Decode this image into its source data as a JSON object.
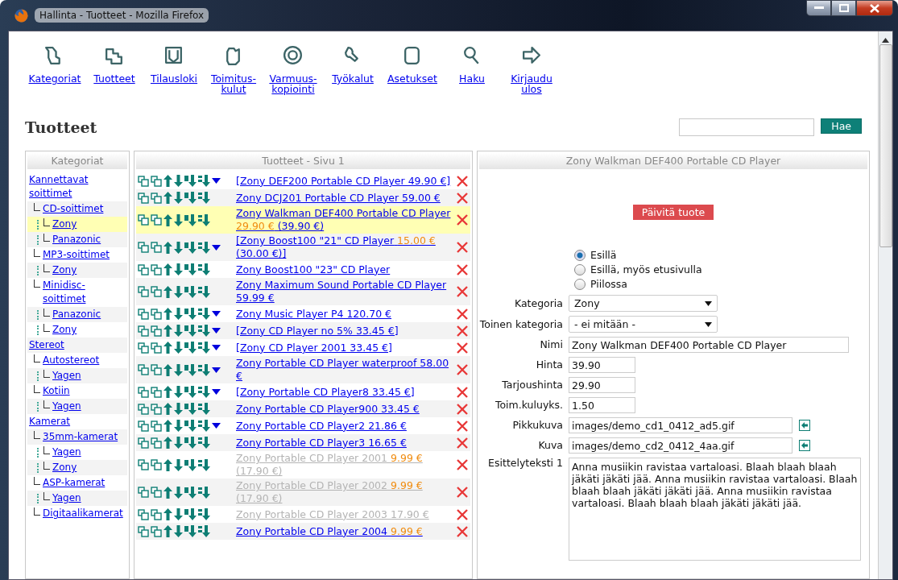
{
  "window": {
    "title": "Hallinta - Tuotteet - Mozilla Firefox"
  },
  "nav": [
    {
      "label": "Kategoriat"
    },
    {
      "label": "Tuotteet"
    },
    {
      "label": "Tilausloki"
    },
    {
      "label": "Toimitus-kulut"
    },
    {
      "label": "Varmuus-kopiointi"
    },
    {
      "label": "Työkalut"
    },
    {
      "label": "Asetukset"
    },
    {
      "label": "Haku"
    },
    {
      "label": "Kirjaudu ulos"
    }
  ],
  "page_title": "Tuotteet",
  "search": {
    "button": "Hae"
  },
  "categories": {
    "header": "Kategoriat",
    "items": [
      {
        "label": "Kannettavat soittimet",
        "selected": false,
        "children": [
          {
            "label": "CD-soittimet",
            "selected": false,
            "children": [
              {
                "label": "Zony",
                "selected": true
              },
              {
                "label": "Panazonic",
                "selected": false
              }
            ]
          },
          {
            "label": "MP3-soittimet",
            "selected": false,
            "children": [
              {
                "label": "Zony",
                "selected": false
              }
            ]
          },
          {
            "label": "Minidisc-soittimet",
            "selected": false,
            "children": [
              {
                "label": "Panazonic",
                "selected": false
              },
              {
                "label": "Zony",
                "selected": false
              }
            ]
          }
        ]
      },
      {
        "label": "Stereot",
        "selected": false,
        "children": [
          {
            "label": "Autostereot",
            "selected": false,
            "children": [
              {
                "label": "Yagen",
                "selected": false
              }
            ]
          },
          {
            "label": "Kotiin",
            "selected": false,
            "children": [
              {
                "label": "Yagen",
                "selected": false
              }
            ]
          }
        ]
      },
      {
        "label": "Kamerat",
        "selected": false,
        "children": [
          {
            "label": "35mm-kamerat",
            "selected": false,
            "children": [
              {
                "label": "Yagen",
                "selected": false
              },
              {
                "label": "Zony",
                "selected": false
              }
            ]
          },
          {
            "label": "ASP-kamerat",
            "selected": false,
            "children": [
              {
                "label": "Yagen",
                "selected": false
              }
            ]
          },
          {
            "label": "Digitaalikamerat",
            "selected": false
          }
        ]
      }
    ]
  },
  "products": {
    "header": "Tuotteet - Sivu 1",
    "rows": [
      {
        "name": "[Zony DEF200 Portable CD Player 49.90 €]",
        "expandable": true,
        "hidden": false,
        "selected": false
      },
      {
        "name": "Zony DCJ201 Portable CD Player 59.00 €",
        "expandable": false,
        "hidden": false,
        "selected": false
      },
      {
        "name": "Zony Walkman DEF400 Portable CD Player",
        "offer": "29.90 €",
        "original": "(39.90 €)",
        "expandable": false,
        "hidden": false,
        "selected": true
      },
      {
        "name": "[Zony Boost100 \"21\" CD Player",
        "offer": "15.00 €",
        "original": "(30.00 €)]",
        "expandable": true,
        "hidden": false,
        "selected": false
      },
      {
        "name": "Zony Boost100 \"23\" CD Player",
        "expandable": false,
        "hidden": false,
        "selected": false
      },
      {
        "name": "Zony Maximum Sound Portable CD Player 59.99 €",
        "expandable": false,
        "hidden": false,
        "selected": false
      },
      {
        "name": "Zony Music Player P4 120.70 €",
        "expandable": true,
        "hidden": false,
        "selected": false
      },
      {
        "name": "[Zony CD Player no 5% 33.45 €]",
        "expandable": true,
        "hidden": false,
        "selected": false
      },
      {
        "name": "[Zony CD Player 2001 33.45 €]",
        "expandable": true,
        "hidden": false,
        "selected": false
      },
      {
        "name": "Zony Portable CD Player waterproof 58.00 €",
        "expandable": true,
        "hidden": false,
        "selected": false
      },
      {
        "name": "[Zony Portable CD Player8 33.45 €]",
        "expandable": true,
        "hidden": false,
        "selected": false
      },
      {
        "name": "Zony Portable CD Player900 33.45 €",
        "expandable": false,
        "hidden": false,
        "selected": false
      },
      {
        "name": "Zony Portable CD Player2 21.86 €",
        "expandable": true,
        "hidden": false,
        "selected": false
      },
      {
        "name": "Zony Portable CD Player3 16.65 €",
        "expandable": false,
        "hidden": false,
        "selected": false
      },
      {
        "name": "Zony Portable CD Player 2001",
        "offer": "9.99 €",
        "original": "(17.90 €)",
        "expandable": false,
        "hidden": true,
        "selected": false
      },
      {
        "name": "Zony Portable CD Player 2002",
        "offer": "9.99 €",
        "original": "(17.90 €)",
        "expandable": false,
        "hidden": true,
        "selected": false
      },
      {
        "name": "Zony Portable CD Player 2003 17.90 €",
        "expandable": false,
        "hidden": true,
        "selected": false
      },
      {
        "name": "Zony Portable CD Player 2004",
        "offer": "9.99 €",
        "expandable": false,
        "hidden": false,
        "selected": false
      }
    ]
  },
  "detail": {
    "header": "Zony Walkman DEF400 Portable CD Player",
    "update_button": "Päivitä tuote",
    "visibility": [
      {
        "label": "Esillä",
        "selected": true
      },
      {
        "label": "Esillä, myös etusivulla",
        "selected": false
      },
      {
        "label": "Piilossa",
        "selected": false
      }
    ],
    "fields": [
      {
        "kind": "select",
        "label": "Kategoria",
        "value": "Zony"
      },
      {
        "kind": "select",
        "label": "Toinen kategoria",
        "value": "- ei mitään -"
      },
      {
        "kind": "text",
        "label": "Nimi",
        "value": "Zony Walkman DEF400 Portable CD Player"
      },
      {
        "kind": "number",
        "label": "Hinta",
        "value": "39.90"
      },
      {
        "kind": "number",
        "label": "Tarjoushinta",
        "value": "29.90"
      },
      {
        "kind": "number",
        "label": "Toim.kuluyks.",
        "value": "1.50"
      },
      {
        "kind": "image",
        "label": "Pikkukuva",
        "value": "images/demo_cd1_0412_ad5.gif"
      },
      {
        "kind": "image",
        "label": "Kuva",
        "value": "images/demo_cd2_0412_4aa.gif"
      },
      {
        "kind": "textarea",
        "label": "Esittelyteksti 1",
        "value": "Anna musiikin ravistaa vartaloasi. Blaah blaah blaah jäkäti jäkäti jää. Anna musiikin ravistaa vartaloasi. Blaah blaah blaah jäkäti jäkäti jää. Anna musiikin ravistaa vartaloasi. Blaah blaah blaah jäkäti jäkäti jää."
      }
    ]
  }
}
